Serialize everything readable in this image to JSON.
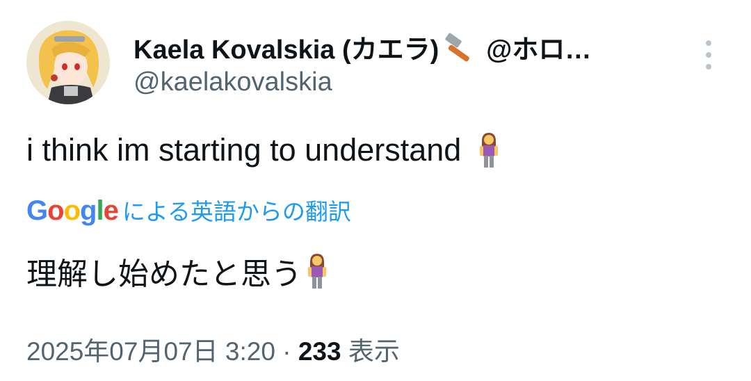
{
  "author": {
    "display_name": "Kaela Kovalskia (カエラ)",
    "name_suffix": "@ホロ…",
    "handle": "@kaelakovalskia",
    "avatar_icon": "anime-avatar",
    "badge_icon": "hammer-icon"
  },
  "tweet": {
    "text": "i think im starting to understand",
    "emoji_icon": "woman-standing-icon"
  },
  "translation": {
    "provider": "Google",
    "label": "による英語からの翻訳",
    "text": "理解し始めたと思う"
  },
  "meta": {
    "timestamp": "2025年07月07日 3:20",
    "separator": "·",
    "views_count": "233",
    "views_label": "表示"
  },
  "colors": {
    "text": "#0f1419",
    "muted": "#536471",
    "link": "#1d9bf0"
  }
}
